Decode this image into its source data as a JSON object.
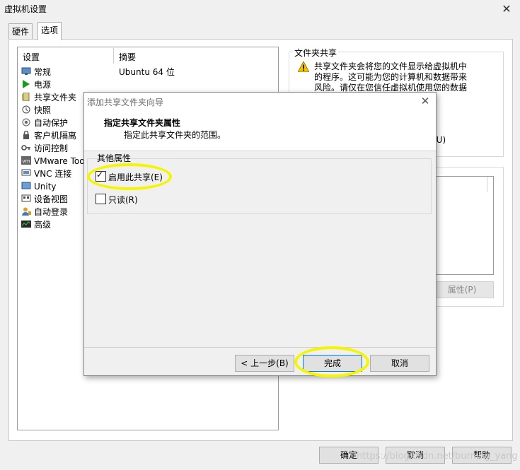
{
  "window": {
    "title": "虚拟机设置",
    "close_glyph": "✕"
  },
  "tabs": [
    {
      "label": "硬件",
      "selected": false
    },
    {
      "label": "选项",
      "selected": true
    }
  ],
  "settings_list": {
    "col_setting": "设置",
    "col_summary": "摘要",
    "items": [
      {
        "label": "常规",
        "icon": "monitor-icon",
        "value": "Ubuntu 64 位"
      },
      {
        "label": "电源",
        "icon": "play-icon",
        "value": ""
      },
      {
        "label": "共享文件夹",
        "icon": "shared-folder-icon",
        "value": ""
      },
      {
        "label": "快照",
        "icon": "snapshot-icon",
        "value": ""
      },
      {
        "label": "自动保护",
        "icon": "autoprotect-icon",
        "value": ""
      },
      {
        "label": "客户机隔离",
        "icon": "lock-icon",
        "value": ""
      },
      {
        "label": "访问控制",
        "icon": "key-icon",
        "value": ""
      },
      {
        "label": "VMware Too",
        "icon": "vm-icon",
        "value": ""
      },
      {
        "label": "VNC 连接",
        "icon": "vnc-icon",
        "value": ""
      },
      {
        "label": "Unity",
        "icon": "unity-icon",
        "value": ""
      },
      {
        "label": "设备视图",
        "icon": "device-view-icon",
        "value": ""
      },
      {
        "label": "自动登录",
        "icon": "user-icon",
        "value": ""
      },
      {
        "label": "高级",
        "icon": "advanced-icon",
        "value": ""
      }
    ]
  },
  "shared_folders_panel": {
    "group_title": "文件夹共享",
    "warning_lines": [
      "共享文件夹会将您的文件显示给虚拟机中",
      "的程序。这可能为您的计算机和数据带来",
      "风险。请仅在您信任虚拟机使用您的数据"
    ],
    "u_option": "(U)",
    "properties_button": "属性(P)"
  },
  "footer_buttons": {
    "ok": "确定",
    "cancel": "取消",
    "help": "帮助"
  },
  "wizard": {
    "title": "添加共享文件夹向导",
    "heading": "指定共享文件夹属性",
    "subheading": "指定此共享文件夹的范围。",
    "group_label": "其他属性",
    "enable_share": {
      "label": "启用此共享(E)",
      "checked": true
    },
    "read_only": {
      "label": "只读(R)",
      "checked": false
    },
    "back_button": "< 上一步(B)",
    "finish_button": "完成",
    "cancel_button": "取消"
  },
  "watermark": "https://blog.csdn.net/burning_yang",
  "colors": {
    "highlight": "#f5f500",
    "warning": "#f2c200",
    "power_green": "#1a9a1a"
  }
}
